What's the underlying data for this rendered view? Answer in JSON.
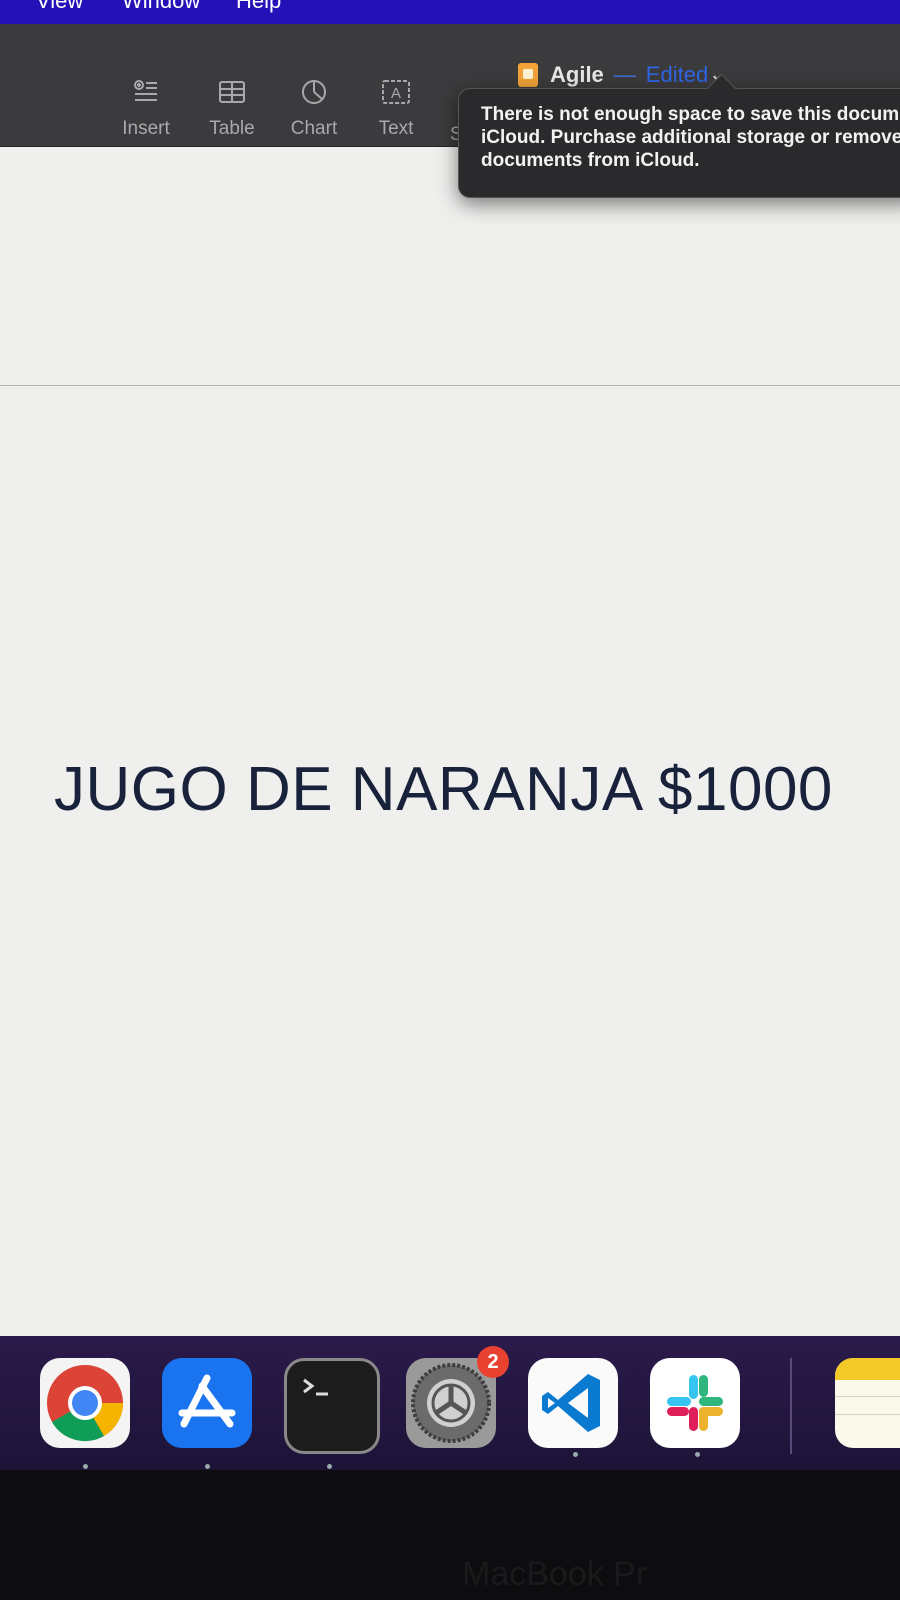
{
  "menubar": {
    "items": [
      "View",
      "Window",
      "Help"
    ]
  },
  "document": {
    "name": "Agile",
    "separator": "—",
    "status": "Edited"
  },
  "toolbar": {
    "buttons": [
      "Insert",
      "Table",
      "Chart",
      "Text"
    ],
    "partial": "S"
  },
  "popover": {
    "lines": [
      "There is not enough space to save this docum",
      "iCloud. Purchase additional storage or remove",
      "documents from iCloud."
    ]
  },
  "page": {
    "text": "JUGO DE NARANJA $1000"
  },
  "dock": {
    "apps": [
      "chrome-icon",
      "app-store-icon",
      "terminal-icon",
      "system-preferences-icon",
      "vscode-icon",
      "slack-icon",
      "notes-icon"
    ],
    "system_preferences_badge": "2"
  },
  "bezel": {
    "label": "MacBook Pr"
  }
}
